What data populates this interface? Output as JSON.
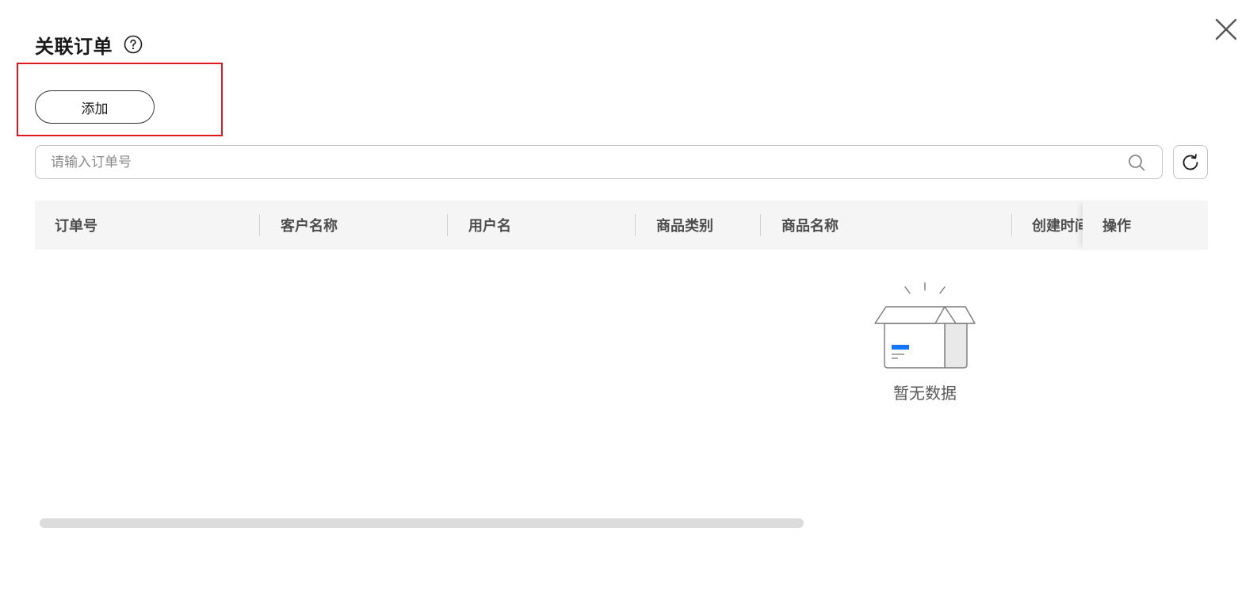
{
  "dialog": {
    "title": "关联订单",
    "help_icon": "question-circle-icon",
    "close_icon": "close-icon"
  },
  "toolbar": {
    "add_label": "添加"
  },
  "search": {
    "placeholder": "请输入订单号",
    "value": "",
    "search_icon": "search-icon",
    "refresh_icon": "refresh-icon"
  },
  "table": {
    "columns": [
      "订单号",
      "客户名称",
      "用户名",
      "商品类别",
      "商品名称",
      "创建时间"
    ],
    "action_column": "操作",
    "rows": []
  },
  "empty_state": {
    "icon": "empty-box-icon",
    "text": "暂无数据"
  },
  "colors": {
    "highlight": "#e0191e",
    "accent": "#1476ff",
    "header_bg": "#f5f5f5"
  }
}
